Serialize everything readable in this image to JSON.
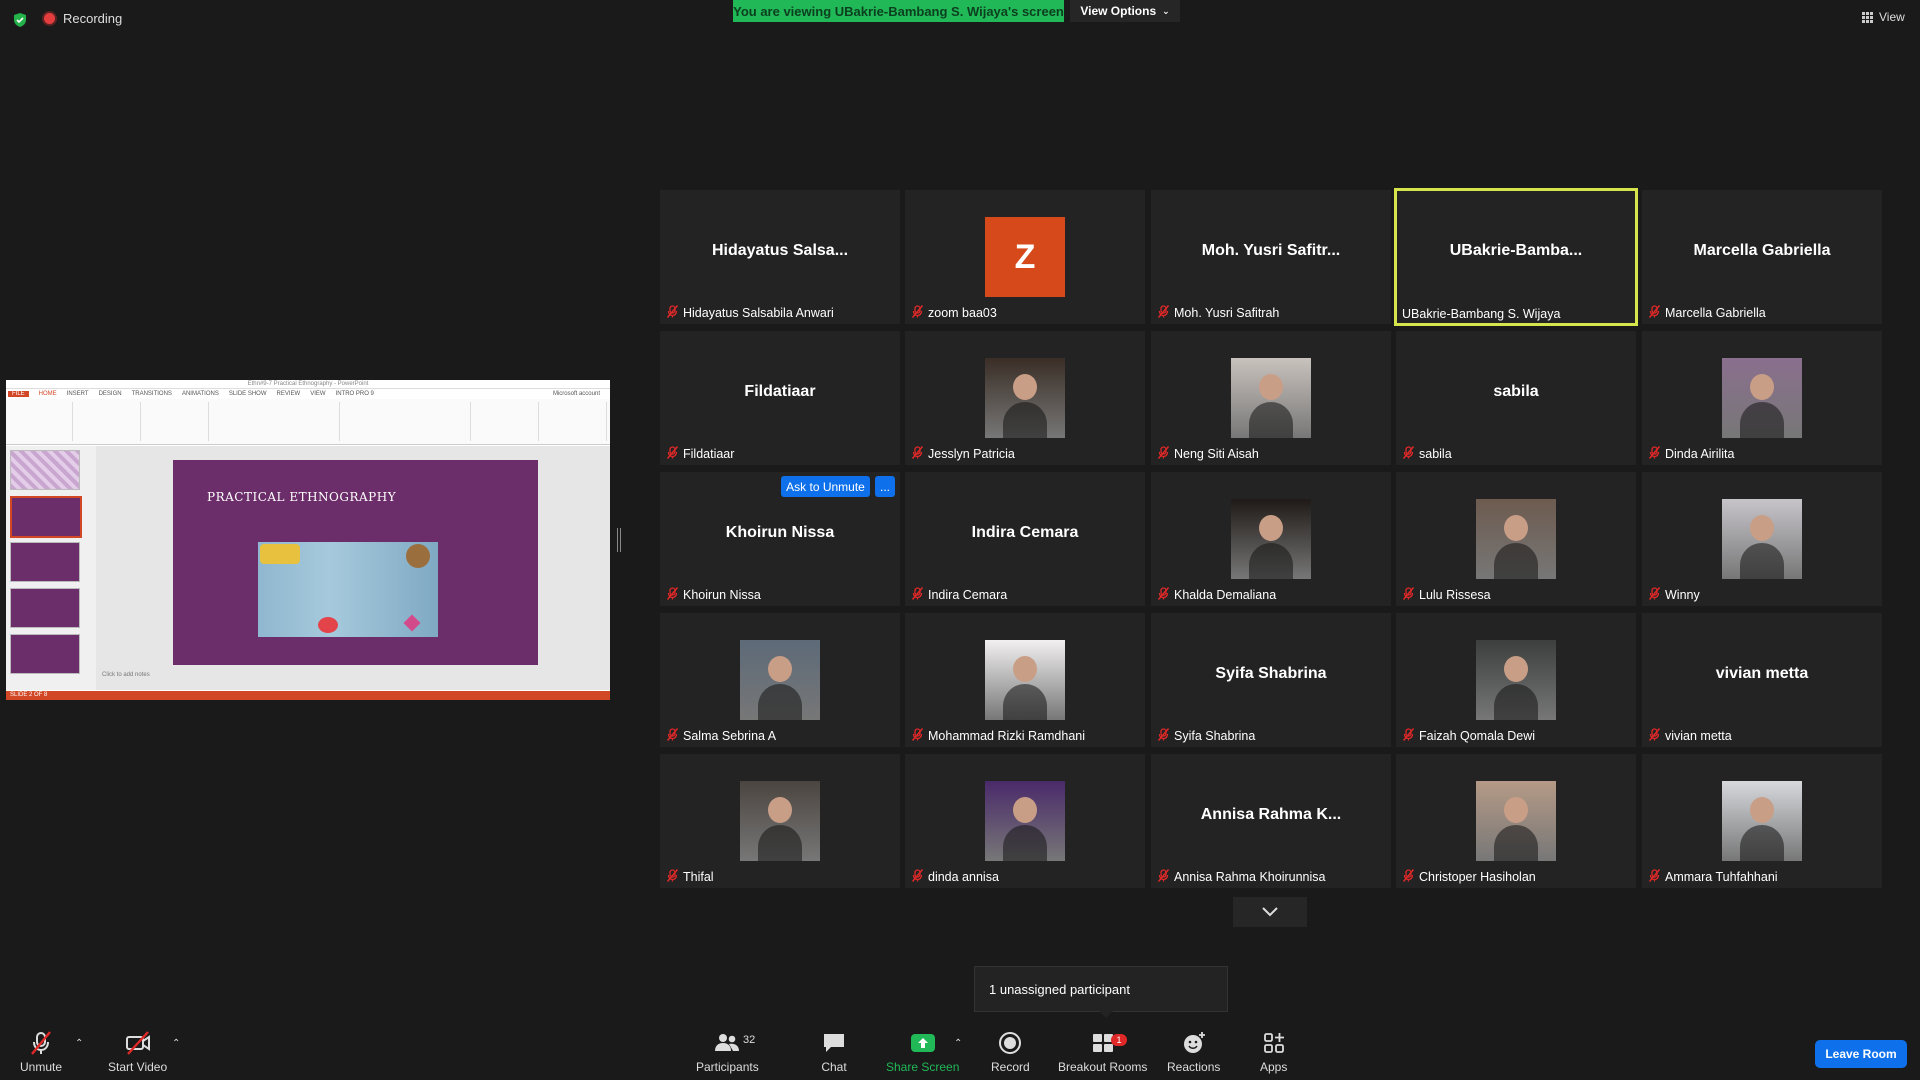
{
  "topbar": {
    "recording_label": "Recording",
    "banner_text": "You are viewing UBakrie-Bambang S. Wijaya's screen",
    "view_options_label": "View Options",
    "view_label": "View"
  },
  "shared_screen": {
    "window_title": "Ethn#9-7 Practical Ethnography - PowerPoint",
    "file_tab": "FILE",
    "tabs": [
      "HOME",
      "INSERT",
      "DESIGN",
      "TRANSITIONS",
      "ANIMATIONS",
      "SLIDE SHOW",
      "REVIEW",
      "VIEW",
      "INTRO PRO 9"
    ],
    "account": "Microsoft account",
    "slide_title": "PRACTICAL ETHNOGRAPHY",
    "notes_placeholder": "Click to add notes",
    "status": "SLIDE 2 OF 8"
  },
  "ask_to_unmute_label": "Ask to Unmute",
  "more_label": "...",
  "participants": [
    {
      "big": "Hidayatus  Salsa...",
      "name": "Hidayatus Salsabila Anwari",
      "type": "name",
      "muted": true
    },
    {
      "big": "Z",
      "name": "zoom baa03",
      "type": "avatar",
      "muted": true
    },
    {
      "big": "Moh.  Yusri  Safitr...",
      "name": "Moh. Yusri Safitrah",
      "type": "name",
      "muted": true
    },
    {
      "big": "UBakrie-Bamba...",
      "name": "UBakrie-Bambang S. Wijaya",
      "type": "name",
      "muted": false,
      "active": true
    },
    {
      "big": "Marcella  Gabriella",
      "name": "Marcella Gabriella",
      "type": "name",
      "muted": true
    },
    {
      "big": "Fildatiaar",
      "name": "Fildatiaar",
      "type": "name",
      "muted": true
    },
    {
      "big": "",
      "name": "Jesslyn Patricia",
      "type": "photo",
      "muted": true
    },
    {
      "big": "",
      "name": "Neng Siti Aisah",
      "type": "photo",
      "muted": true
    },
    {
      "big": "sabila",
      "name": "sabila",
      "type": "name",
      "muted": true
    },
    {
      "big": "",
      "name": "Dinda Airilita",
      "type": "photo",
      "muted": true
    },
    {
      "big": "Khoirun  Nissa",
      "name": "Khoirun Nissa",
      "type": "name",
      "muted": true
    },
    {
      "big": "Indira  Cemara",
      "name": "Indira Cemara",
      "type": "name",
      "muted": true
    },
    {
      "big": "",
      "name": "Khalda Demaliana",
      "type": "photo",
      "muted": true
    },
    {
      "big": "",
      "name": "Lulu Rissesa",
      "type": "photo",
      "muted": true
    },
    {
      "big": "",
      "name": "Winny",
      "type": "photo",
      "muted": true
    },
    {
      "big": "",
      "name": "Salma Sebrina A",
      "type": "photo",
      "muted": true
    },
    {
      "big": "",
      "name": "Mohammad Rizki Ramdhani",
      "type": "photo",
      "muted": true
    },
    {
      "big": "Syifa  Shabrina",
      "name": "Syifa Shabrina",
      "type": "name",
      "muted": true
    },
    {
      "big": "",
      "name": "Faizah Qomala Dewi",
      "type": "photo",
      "muted": true
    },
    {
      "big": "vivian  metta",
      "name": "vivian metta",
      "type": "name",
      "muted": true
    },
    {
      "big": "",
      "name": "Thifal",
      "type": "photo",
      "muted": true
    },
    {
      "big": "",
      "name": "dinda annisa",
      "type": "photo",
      "muted": true
    },
    {
      "big": "Annisa  Rahma  K...",
      "name": "Annisa Rahma Khoirunnisa",
      "type": "name",
      "muted": true
    },
    {
      "big": "",
      "name": "Christoper Hasiholan",
      "type": "photo",
      "muted": true
    },
    {
      "big": "",
      "name": "Ammara Tuhfahhani",
      "type": "photo",
      "muted": true
    }
  ],
  "photo_colors": [
    "#3a2e26",
    "#c9c2bd",
    "#8a6f8e",
    "#1f1a17",
    "#6d5b4f",
    "#c7c4c9",
    "#5d6a78",
    "#f2f0f0",
    "#3c3f3e",
    "#4b4540",
    "#4a2a6a",
    "#b59a86",
    "#d6d8dc",
    "#5f7f73"
  ],
  "avatar_color": "#d6491b",
  "tooltip": "1 unassigned participant",
  "toolbar": {
    "unmute": "Unmute",
    "start_video": "Start Video",
    "participants": "Participants",
    "participants_count": "32",
    "chat": "Chat",
    "share_screen": "Share Screen",
    "record": "Record",
    "breakout_rooms": "Breakout Rooms",
    "breakout_badge": "1",
    "reactions": "Reactions",
    "apps": "Apps",
    "leave_room": "Leave Room"
  }
}
